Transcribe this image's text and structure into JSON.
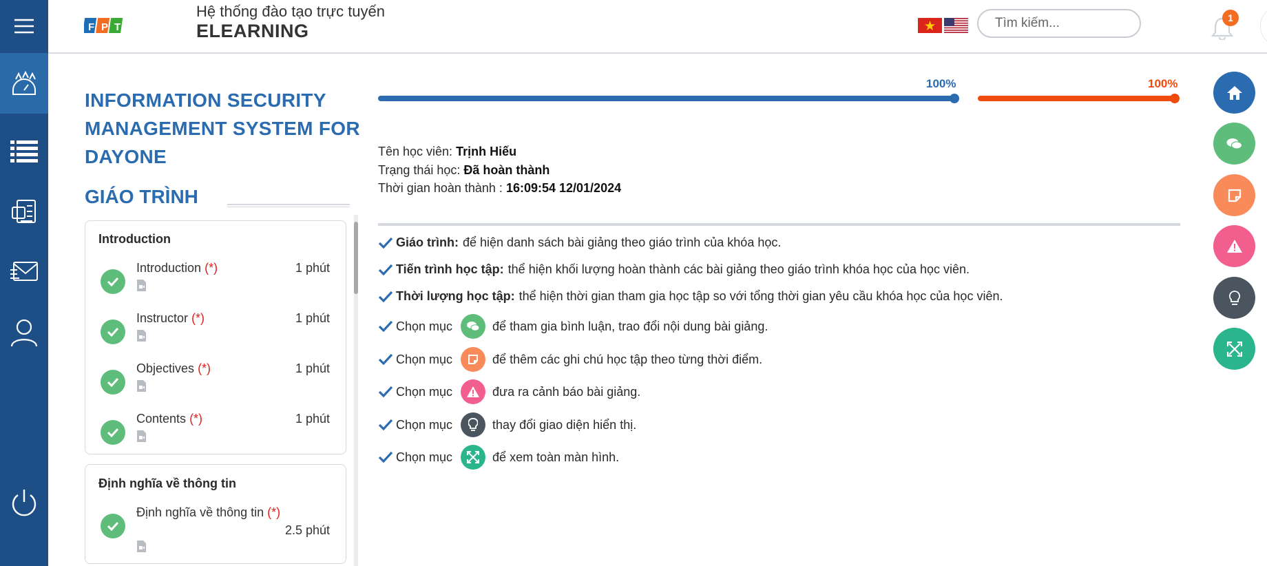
{
  "header": {
    "subtitle": "Hệ thống đào tạo trực tuyến",
    "title": "ELEARNING",
    "search_placeholder": "Tìm kiếm...",
    "notification_count": "1"
  },
  "sidebar": {
    "items": [
      {
        "icon": "menu-icon"
      },
      {
        "icon": "dashboard-icon",
        "active": true
      },
      {
        "icon": "list-icon"
      },
      {
        "icon": "documents-icon"
      },
      {
        "icon": "mail-icon"
      },
      {
        "icon": "user-icon"
      },
      {
        "icon": "power-icon"
      }
    ]
  },
  "course": {
    "title": "INFORMATION SECURITY MANAGEMENT SYSTEM FOR DAYONE",
    "curriculum_heading": "GIÁO TRÌNH",
    "sections": [
      {
        "title": "Introduction",
        "lessons": [
          {
            "name": "Introduction",
            "required": "(*)",
            "duration": "1 phút"
          },
          {
            "name": "Instructor",
            "required": "(*)",
            "duration": "1 phút"
          },
          {
            "name": "Objectives",
            "required": "(*)",
            "duration": "1 phút"
          },
          {
            "name": "Contents",
            "required": "(*)",
            "duration": "1 phút"
          }
        ]
      },
      {
        "title": "Định nghĩa về thông tin",
        "lessons": [
          {
            "name": "Định nghĩa về thông tin",
            "required": "(*)",
            "duration": "2.5 phút"
          }
        ]
      }
    ]
  },
  "progress": {
    "learning_progress": {
      "label": "100%",
      "value": 100,
      "color": "#2b6cb0"
    },
    "study_duration": {
      "label": "100%",
      "value": 100,
      "color": "#f04b0f"
    }
  },
  "student": {
    "name_label": "Tên học viên:",
    "name": "Trịnh Hiếu",
    "status_label": "Trạng thái học:",
    "status": "Đã hoàn thành",
    "completed_label": "Thời gian hoàn thành :",
    "completed_at": "16:09:54 12/01/2024"
  },
  "guide": [
    {
      "bold": "Giáo trình:",
      "text": "để hiện danh sách bài giảng theo giáo trình của khóa học."
    },
    {
      "bold": "Tiến trình học tập:",
      "text": "thể hiện khối lượng hoàn thành các bài giảng theo giáo trình khóa học của học viên."
    },
    {
      "bold": "Thời lượng học tập:",
      "text": "thể hiện thời gian tham gia học tập so với tổng thời gian yêu cầu khóa học của học viên."
    },
    {
      "prefix": "Chọn mục",
      "icon": "comments-icon",
      "color": "#5ebd7a",
      "text": "để tham gia bình luận, trao đổi nội dung bài giảng."
    },
    {
      "prefix": "Chọn mục",
      "icon": "note-icon",
      "color": "#f98a5a",
      "text": "để thêm các ghi chú học tập theo từng thời điểm."
    },
    {
      "prefix": "Chọn mục",
      "icon": "warning-icon",
      "color": "#f25f8e",
      "text": "đưa ra cảnh báo bài giảng."
    },
    {
      "prefix": "Chọn mục",
      "icon": "lightbulb-icon",
      "color": "#4a5560",
      "text": "thay đổi giao diện hiển thị."
    },
    {
      "prefix": "Chọn mục",
      "icon": "fullscreen-icon",
      "color": "#2bb58d",
      "text": "để xem toàn màn hình."
    }
  ],
  "fabs": [
    {
      "icon": "home-icon",
      "color": "#2b6cb0"
    },
    {
      "icon": "comments-icon",
      "color": "#5ebd7a"
    },
    {
      "icon": "note-icon",
      "color": "#f98a5a"
    },
    {
      "icon": "warning-icon",
      "color": "#f25f8e"
    },
    {
      "icon": "lightbulb-icon",
      "color": "#4a5560"
    },
    {
      "icon": "fullscreen-icon",
      "color": "#2bb58d"
    }
  ]
}
